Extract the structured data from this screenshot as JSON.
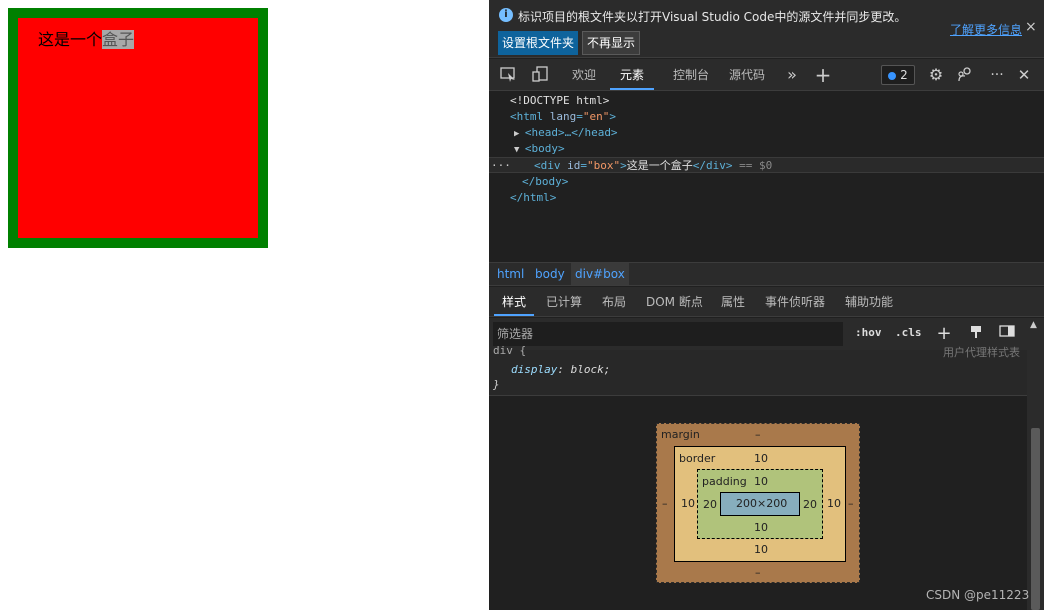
{
  "page": {
    "box_text_plain": "这是一个",
    "box_text_highlight": "盒子",
    "box_border_color": "#008000",
    "box_bg_color": "#ff0000"
  },
  "infobar": {
    "message": "标识项目的根文件夹以打开Visual Studio Code中的源文件并同步更改。",
    "set_root_button": "设置根文件夹",
    "dont_show_button": "不再显示",
    "learn_more": "了解更多信息",
    "close": "×"
  },
  "toolbar": {
    "tabs": [
      "欢迎",
      "元素",
      "控制台",
      "源代码"
    ],
    "active_tab": "元素",
    "more": "»",
    "add": "+",
    "issues_count": "2",
    "settings": "⚙",
    "dots": "···",
    "close": "✕"
  },
  "dom": {
    "line1": "<!DOCTYPE html>",
    "html_open_tag": "<html",
    "html_attr": "lang",
    "html_attr_val": "\"en\"",
    "head_line": "<head>…</head>",
    "body_open": "<body>",
    "div_open": "<div",
    "div_attr": "id",
    "div_attr_val": "\"box\"",
    "div_text": "这是一个盒子",
    "div_close": "</div>",
    "div_marker": "== $0",
    "body_close": "</body>",
    "html_close": "</html>",
    "gutter": "···"
  },
  "breadcrumb": [
    "html",
    "body",
    "div#box"
  ],
  "style_tabs": [
    "样式",
    "已计算",
    "布局",
    "DOM 断点",
    "属性",
    "事件侦听器",
    "辅助功能"
  ],
  "filter": {
    "placeholder": "筛选器",
    "hov": ":hov",
    "cls": ".cls"
  },
  "rule": {
    "selector": "div {",
    "source": "用户代理样式表",
    "property": "display",
    "value": "block",
    "close": "}"
  },
  "box_model": {
    "margin_label": "margin",
    "margin_top": "–",
    "margin_bottom": "–",
    "margin_left": "–",
    "margin_right": "–",
    "border_label": "border",
    "border_top": "10",
    "border_bottom": "10",
    "border_left": "10",
    "border_right": "10",
    "padding_label": "padding",
    "padding_top": "10",
    "padding_bottom": "10",
    "padding_left": "20",
    "padding_right": "20",
    "content": "200×200"
  },
  "watermark": "CSDN @pe11223"
}
